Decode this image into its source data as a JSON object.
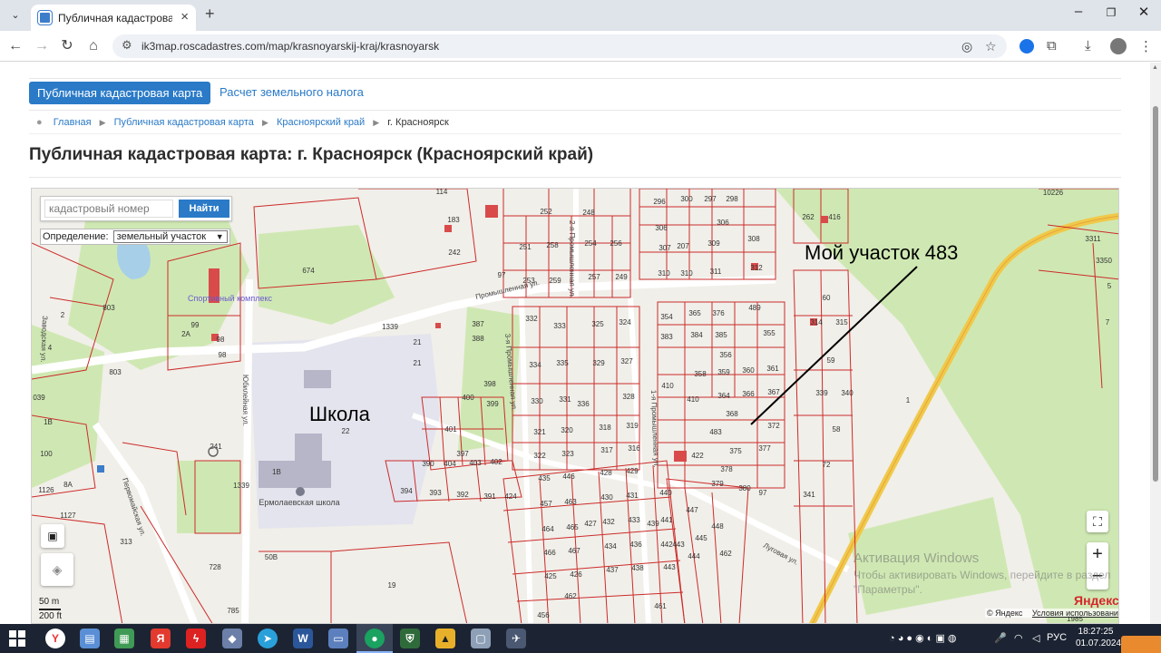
{
  "browser": {
    "tab_title": "Публичная кадастровая карта",
    "url": "ik3map.roscadastres.com/map/krasnoyarskij-kraj/krasnoyarsk"
  },
  "nav": {
    "active": "Публичная кадастровая карта",
    "tax_link": "Расчет земельного налога"
  },
  "breadcrumbs": [
    "Главная",
    "Публичная кадастровая карта",
    "Красноярский край",
    "г. Красноярск"
  ],
  "page_title": "Публичная кадастровая карта: г. Красноярск (Красноярский край)",
  "map": {
    "search": {
      "placeholder": "кадастровый номер",
      "button": "Найти"
    },
    "definition": {
      "label": "Определение:",
      "value": "земельный участок"
    },
    "annotation": "Мой участок 483",
    "school_note": "Школа",
    "school_name": "Ермолаевская школа",
    "sport_complex": "Спортивный комплекс",
    "streets": [
      "Промышленная ул.",
      "2-я Промышленная ул.",
      "3-я Промышленная ул.",
      "1-я Промышленная ул.",
      "Юбилейная ул.",
      "Первомайская ул.",
      "Луговая ул.",
      "Заводская ул."
    ],
    "parcels": [
      "114",
      "183",
      "242",
      "97",
      "674",
      "803",
      "99",
      "2A",
      "98",
      "1339",
      "21",
      "387",
      "388",
      "252",
      "251",
      "258",
      "253",
      "259",
      "248",
      "254",
      "257",
      "256",
      "249",
      "296",
      "300",
      "297",
      "298",
      "306",
      "307",
      "207",
      "309",
      "308",
      "310",
      "311",
      "312",
      "262",
      "416",
      "60",
      "314",
      "315",
      "59",
      "339",
      "340",
      "58",
      "72",
      "341",
      "489",
      "354",
      "365",
      "376",
      "383",
      "384",
      "385",
      "355",
      "356",
      "358",
      "359",
      "360",
      "361",
      "410",
      "364",
      "366",
      "367",
      "368",
      "483",
      "372",
      "422",
      "375",
      "377",
      "378",
      "379",
      "380",
      "332",
      "333",
      "325",
      "324",
      "334",
      "335",
      "329",
      "327",
      "330",
      "331",
      "336",
      "328",
      "321",
      "320",
      "318",
      "319",
      "322",
      "323",
      "317",
      "316",
      "398",
      "399",
      "400",
      "401",
      "397",
      "403",
      "402",
      "390",
      "404",
      "394",
      "393",
      "392",
      "391",
      "424",
      "435",
      "446",
      "428",
      "429",
      "457",
      "463",
      "430",
      "431",
      "440",
      "464",
      "465",
      "427",
      "432",
      "433",
      "439",
      "441",
      "466",
      "467",
      "434",
      "436",
      "442",
      "443",
      "444",
      "425",
      "426",
      "437",
      "438",
      "462",
      "456",
      "461",
      "447",
      "448",
      "445",
      "100",
      "1126",
      "1127",
      "313",
      "728",
      "785",
      "1В",
      "50В",
      "19",
      "241",
      "1339",
      "039",
      "1985",
      "3311",
      "3350",
      "1B",
      "7",
      "10226",
      "1",
      "22"
    ],
    "scale": [
      "50 m",
      "200 ft"
    ],
    "copyright": "© Яндекс",
    "terms": "Условия использования",
    "yandex_logo": "Яндекс",
    "watermark_title": "Активация Windows",
    "watermark_text": "Чтобы активировать Windows, перейдите в раздел \"Параметры\"."
  },
  "taskbar": {
    "lang": "РУС",
    "time": "18:27:25",
    "date": "01.07.2024"
  }
}
